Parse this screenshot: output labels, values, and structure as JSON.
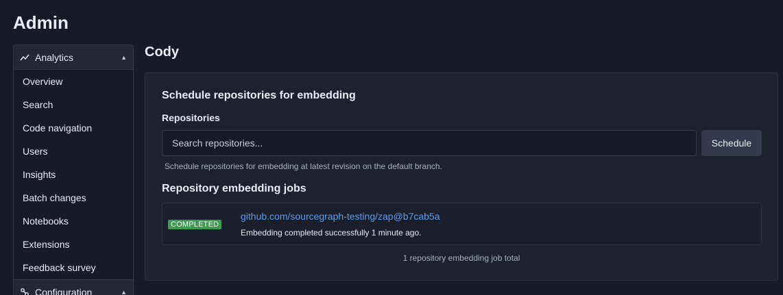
{
  "page_title": "Admin",
  "sidebar": {
    "sections": [
      {
        "label": "Analytics",
        "icon": "chart-line-icon",
        "expanded": true,
        "items": [
          {
            "label": "Overview"
          },
          {
            "label": "Search"
          },
          {
            "label": "Code navigation"
          },
          {
            "label": "Users"
          },
          {
            "label": "Insights"
          },
          {
            "label": "Batch changes"
          },
          {
            "label": "Notebooks"
          },
          {
            "label": "Extensions"
          },
          {
            "label": "Feedback survey"
          }
        ]
      },
      {
        "label": "Configuration",
        "icon": "cog-network-icon",
        "expanded": true
      }
    ]
  },
  "main": {
    "title": "Cody",
    "schedule": {
      "title": "Schedule repositories for embedding",
      "field_label": "Repositories",
      "search_placeholder": "Search repositories...",
      "button_label": "Schedule",
      "help": "Schedule repositories for embedding at latest revision on the default branch."
    },
    "jobs": {
      "title": "Repository embedding jobs",
      "items": [
        {
          "status": "COMPLETED",
          "repo": "github.com/sourcegraph-testing/zap@b7cab5a",
          "description": "Embedding completed successfully 1 minute ago."
        }
      ],
      "total": "1 repository embedding job total"
    }
  },
  "colors": {
    "background": "#181b26",
    "card": "#1d2130",
    "link": "#5d9cec",
    "completed_badge": "#3b9b4f"
  }
}
